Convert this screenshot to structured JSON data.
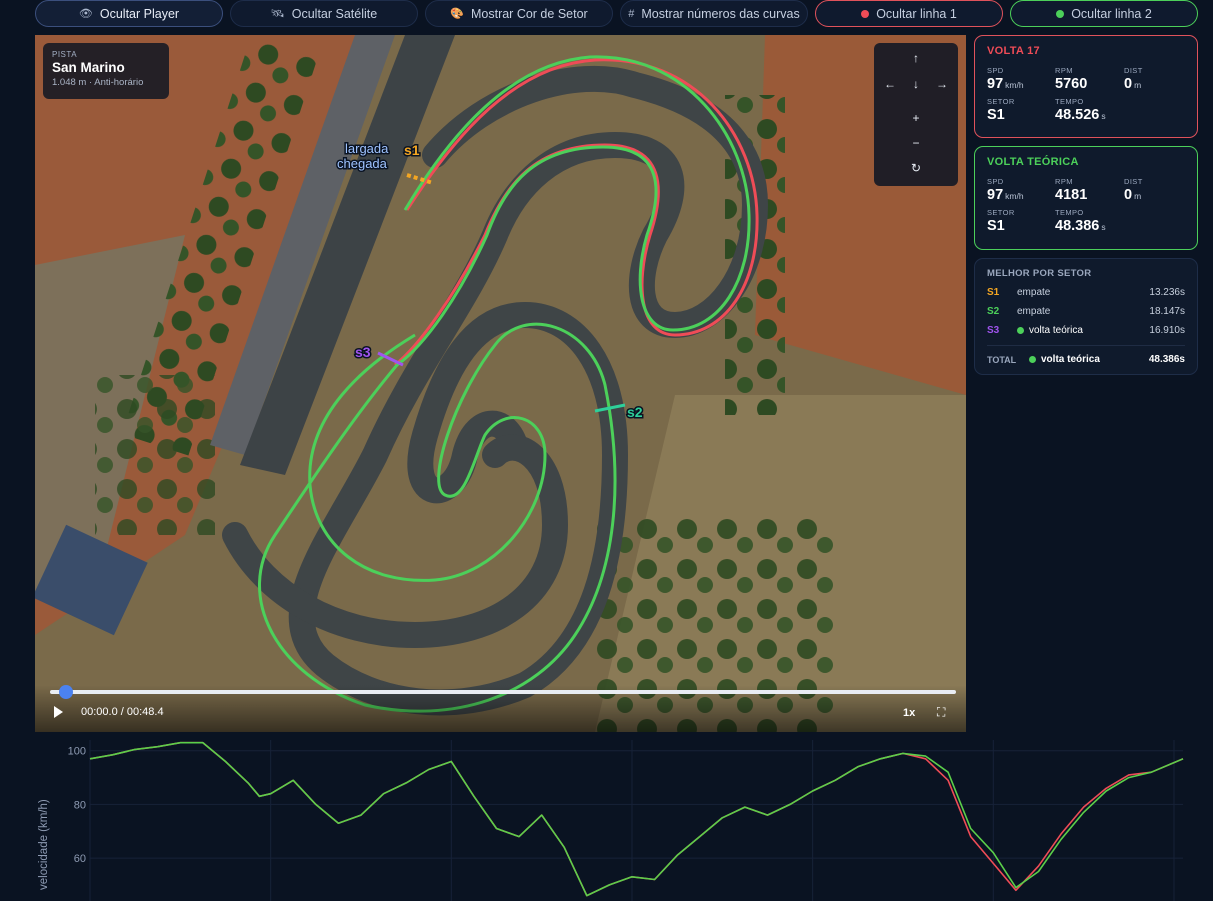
{
  "toolbar": {
    "player_label": "Ocultar Player",
    "satellite_label": "Ocultar Satélite",
    "sector_color_label": "Mostrar Cor de Setor",
    "curve_numbers_label": "Mostrar números das curvas",
    "line1_label": "Ocultar linha 1",
    "line2_label": "Ocultar linha 2"
  },
  "colors": {
    "line1": "#ef4c57",
    "line2": "#4cd05a",
    "s1": "#f4a622",
    "s2": "#2ed09a",
    "s3": "#a054ee",
    "accent": "#4b82f0"
  },
  "track": {
    "label": "PISTA",
    "name": "San Marino",
    "info": "1.048 m · Anti-horário"
  },
  "map_labels": {
    "start_finish_line1": "largada",
    "start_finish_line2": "chegada",
    "s1": "s1",
    "s2": "s2",
    "s3": "s3"
  },
  "player": {
    "time": "00:00.0 / 00:48.4",
    "speed": "1x",
    "progress": 0.0
  },
  "lap": {
    "title": "VOLTA 17",
    "spd_label": "SPD",
    "spd": "97",
    "spd_unit": "km/h",
    "rpm_label": "RPM",
    "rpm": "5760",
    "dist_label": "DIST",
    "dist": "0",
    "dist_unit": "m",
    "sector_label": "SETOR",
    "sector": "S1",
    "time_label": "TEMPO",
    "time": "48.526",
    "time_unit": "s"
  },
  "theoretical": {
    "title": "VOLTA TEÓRICA",
    "spd_label": "SPD",
    "spd": "97",
    "spd_unit": "km/h",
    "rpm_label": "RPM",
    "rpm": "4181",
    "dist_label": "DIST",
    "dist": "0",
    "dist_unit": "m",
    "sector_label": "SETOR",
    "sector": "S1",
    "time_label": "TEMPO",
    "time": "48.386",
    "time_unit": "s"
  },
  "best": {
    "title": "MELHOR POR SETOR",
    "rows": [
      {
        "sector": "S1",
        "winner": "empate",
        "time": "13.236s"
      },
      {
        "sector": "S2",
        "winner": "empate",
        "time": "18.147s"
      },
      {
        "sector": "S3",
        "winner": "volta teórica",
        "time": "16.910s"
      }
    ],
    "total_label": "TOTAL",
    "total_winner": "volta teórica",
    "total_time": "48.386s"
  },
  "chart_data": {
    "type": "line",
    "ylabel": "velocidade (km/h)",
    "yticks": [
      100,
      80,
      60
    ],
    "ylim": [
      44,
      104
    ],
    "xlim": [
      0,
      48.4
    ],
    "grid": true,
    "series": [
      {
        "color": "#ef4c57",
        "x": [
          0,
          1,
          2,
          3,
          4,
          5,
          6,
          7,
          7.5,
          8,
          9,
          10,
          11,
          12,
          13,
          14,
          15,
          16,
          17,
          18,
          19,
          20,
          21,
          22,
          23,
          24,
          25,
          26,
          27,
          28,
          29,
          30,
          31,
          32,
          33,
          34,
          35,
          36,
          37,
          38,
          39,
          40,
          41,
          42,
          43,
          44,
          45,
          46,
          47,
          48.4
        ],
        "y": [
          97,
          98.5,
          100.5,
          101.5,
          103,
          103,
          96,
          88,
          83,
          84,
          89,
          80,
          73,
          76,
          84,
          88,
          93,
          96,
          83,
          71,
          68,
          76,
          64,
          46,
          50,
          53,
          52,
          61,
          68,
          75,
          79,
          76,
          80,
          85,
          89,
          94,
          97,
          99,
          97,
          89,
          68,
          58,
          48,
          57,
          69,
          79,
          86,
          91,
          92,
          97
        ]
      },
      {
        "color": "#5bcf4a",
        "x": [
          0,
          1,
          2,
          3,
          4,
          5,
          6,
          7,
          7.5,
          8,
          9,
          10,
          11,
          12,
          13,
          14,
          15,
          16,
          17,
          18,
          19,
          20,
          21,
          22,
          23,
          24,
          25,
          26,
          27,
          28,
          29,
          30,
          31,
          32,
          33,
          34,
          35,
          36,
          37,
          38,
          39,
          40,
          41,
          42,
          43,
          44,
          45,
          46,
          47,
          48.4
        ],
        "y": [
          97,
          98.5,
          100.5,
          101.5,
          103,
          103,
          96,
          88,
          83,
          84,
          89,
          80,
          73,
          76,
          84,
          88,
          93,
          96,
          83,
          71,
          68,
          76,
          64,
          46,
          50,
          53,
          52,
          61,
          68,
          75,
          79,
          76,
          80,
          85,
          89,
          94,
          97,
          99,
          98,
          92,
          71,
          62,
          49,
          55,
          67,
          77,
          85,
          90,
          92,
          97
        ]
      }
    ]
  }
}
